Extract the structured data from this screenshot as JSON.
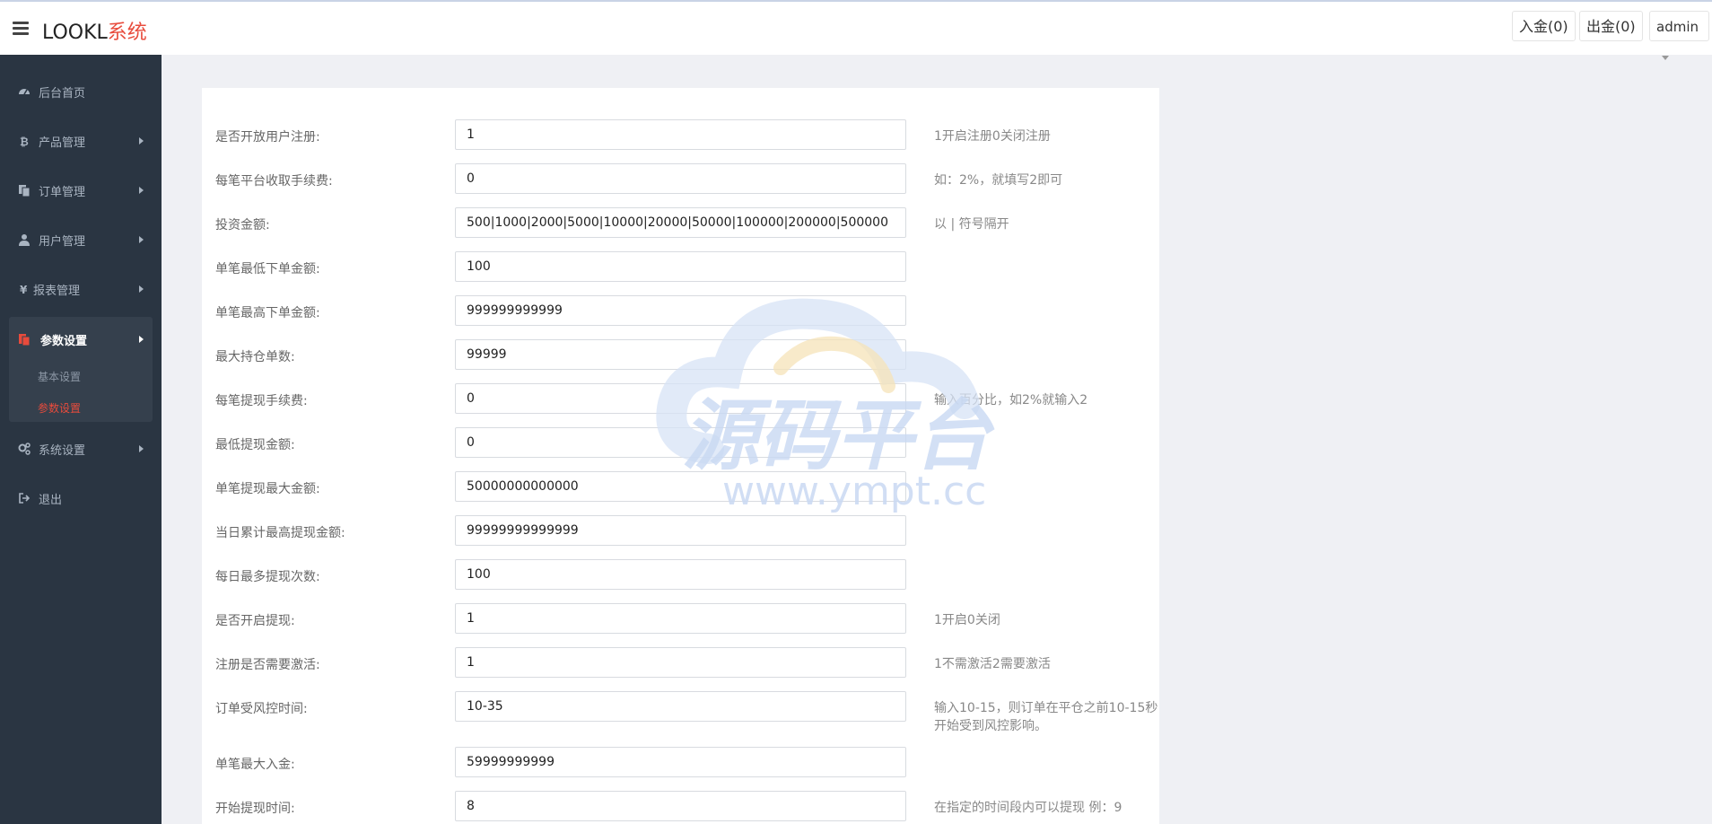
{
  "header": {
    "brand_main": "LOOKL",
    "brand_accent": "系统",
    "deposit_label": "入金(0)",
    "withdraw_label": "出金(0)",
    "user_label": "admin"
  },
  "sidebar": {
    "items": [
      {
        "label": "后台首页",
        "icon": "dashboard-icon"
      },
      {
        "label": "产品管理",
        "icon": "bitcoin-icon"
      },
      {
        "label": "订单管理",
        "icon": "copy-icon"
      },
      {
        "label": "用户管理",
        "icon": "user-icon"
      },
      {
        "label": "报表管理",
        "icon": "yen-icon"
      },
      {
        "label": "参数设置",
        "icon": "files-icon",
        "active": true
      },
      {
        "label": "系统设置",
        "icon": "gears-icon"
      },
      {
        "label": "退出",
        "icon": "sign-out-icon"
      }
    ],
    "sub_items": [
      "基本设置",
      "参数设置"
    ]
  },
  "form": {
    "rows": [
      {
        "label": "是否开放用户注册:",
        "value": "1",
        "hint": "1开启注册0关闭注册"
      },
      {
        "label": "每笔平台收取手续费:",
        "value": "0",
        "hint": "如：2%，就填写2即可"
      },
      {
        "label": "投资金额:",
        "value": "500|1000|2000|5000|10000|20000|50000|100000|200000|500000",
        "hint": "以 | 符号隔开"
      },
      {
        "label": "单笔最低下单金额:",
        "value": "100",
        "hint": ""
      },
      {
        "label": "单笔最高下单金额:",
        "value": "999999999999",
        "hint": ""
      },
      {
        "label": "最大持仓单数:",
        "value": "99999",
        "hint": ""
      },
      {
        "label": "每笔提现手续费:",
        "value": "0",
        "hint": "输入百分比，如2%就输入2"
      },
      {
        "label": "最低提现金额:",
        "value": "0",
        "hint": ""
      },
      {
        "label": "单笔提现最大金额:",
        "value": "50000000000000",
        "hint": ""
      },
      {
        "label": "当日累计最高提现金额:",
        "value": "99999999999999",
        "hint": ""
      },
      {
        "label": "每日最多提现次数:",
        "value": "100",
        "hint": ""
      },
      {
        "label": "是否开启提现:",
        "value": "1",
        "hint": "1开启0关闭"
      },
      {
        "label": "注册是否需要激活:",
        "value": "1",
        "hint": "1不需激活2需要激活"
      },
      {
        "label": "订单受风控时间:",
        "value": "10-35",
        "hint": "输入10-15，则订单在平仓之前10-15秒",
        "hint2": "开始受到风控影响。"
      },
      {
        "label": "单笔最大入金:",
        "value": "59999999999",
        "hint": ""
      },
      {
        "label": "开始提现时间:",
        "value": "8",
        "hint": "在指定的时间段内可以提现 例：9"
      }
    ]
  },
  "watermark": {
    "title": "源码平台",
    "url": "www.ympt.cc"
  },
  "colors": {
    "accent": "#e84b3c",
    "sidebar_bg": "#2a3542",
    "sidebar_group_bg": "#35404d",
    "page_bg": "#eff0f4"
  }
}
